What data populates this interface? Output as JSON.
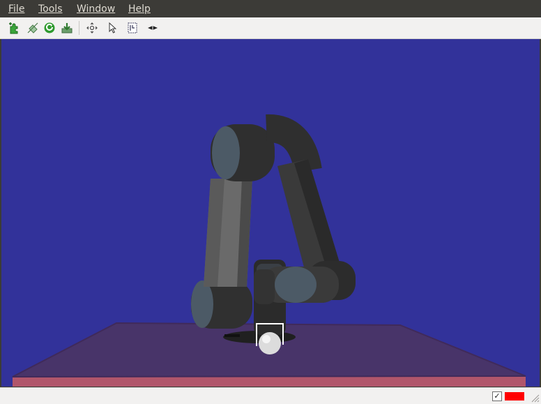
{
  "menubar": {
    "file": "File",
    "tools": "Tools",
    "window": "Window",
    "help": "Help"
  },
  "toolbar": {
    "buttons": [
      "add-display-icon",
      "remove-display-icon",
      "reload-icon",
      "save-download-icon",
      "move-camera-icon",
      "select-cursor-icon",
      "focus-camera-icon",
      "measure-icon"
    ]
  },
  "viewport": {
    "background_color": "#32329a",
    "ground_plane_color": "#4a3566",
    "robot_color": "#3c3c3c",
    "joint_cap_color": "#4c5a66"
  },
  "statusbar": {
    "check_mark": "✓",
    "indicator_color": "#ff0000"
  }
}
